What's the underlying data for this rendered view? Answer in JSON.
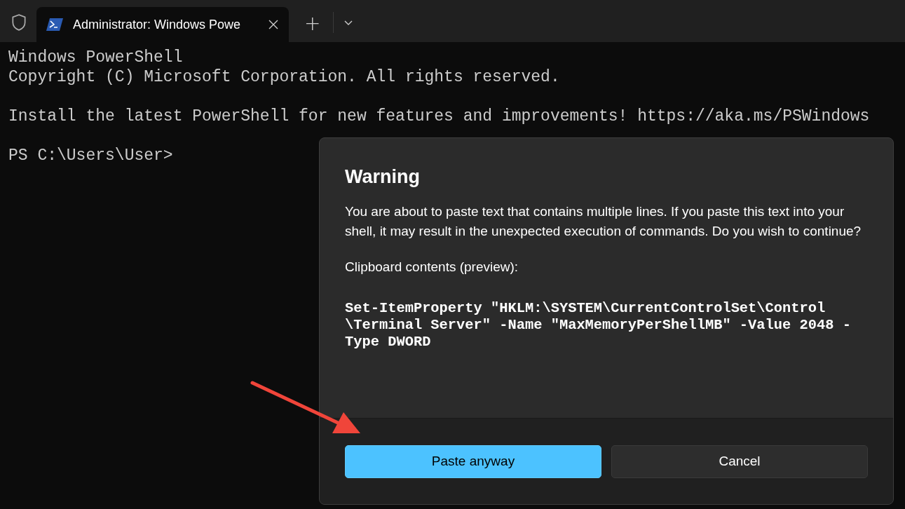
{
  "tabs": [
    {
      "title": "Administrator: Windows Powe",
      "selected": true
    }
  ],
  "new_tab_button": "+",
  "terminal": {
    "blocks": [
      [
        "Windows PowerShell",
        "Copyright (C) Microsoft Corporation. All rights reserved."
      ],
      [
        "Install the latest PowerShell for new features and improvements! https://aka.ms/PSWindows"
      ],
      [
        "PS C:\\Users\\User>"
      ]
    ]
  },
  "dialog": {
    "title": "Warning",
    "message": "You are about to paste text that contains multiple lines. If you paste this text into your shell, it may result in the unexpected execution of commands. Do you wish to continue?",
    "preview_label": "Clipboard contents (preview):",
    "preview_lines": [
      "Set-ItemProperty \"HKLM:\\SYSTEM\\CurrentControlSet\\Control",
      "\\Terminal Server\" -Name \"MaxMemoryPerShellMB\" -Value 2048 -",
      "Type DWORD"
    ],
    "buttons": [
      {
        "label": "Paste anyway",
        "kind": "primary"
      },
      {
        "label": "Cancel",
        "kind": "secondary"
      }
    ]
  }
}
